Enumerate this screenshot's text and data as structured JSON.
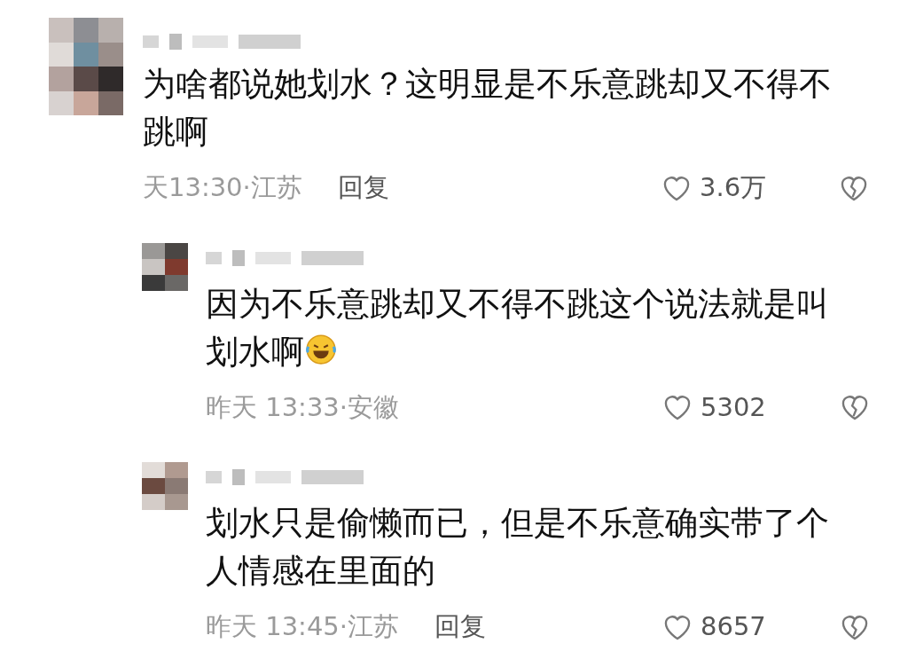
{
  "comments": [
    {
      "kind": "top",
      "text": "为啥都说她划水？这明显是不乐意跳却又不得不跳啊",
      "has_emoji": false,
      "time": "天13:30·江苏",
      "reply": "回复",
      "likes": "3.6万"
    },
    {
      "kind": "reply",
      "text": "因为不乐意跳却又不得不跳这个说法就是叫划水啊",
      "has_emoji": true,
      "time": "昨天 13:33·安徽",
      "likes": "5302"
    },
    {
      "kind": "reply",
      "text": "划水只是偷懒而已，但是不乐意确实带了个人情感在里面的",
      "has_emoji": false,
      "time": "昨天 13:45·江苏",
      "reply": "回复",
      "likes": "8657"
    }
  ]
}
